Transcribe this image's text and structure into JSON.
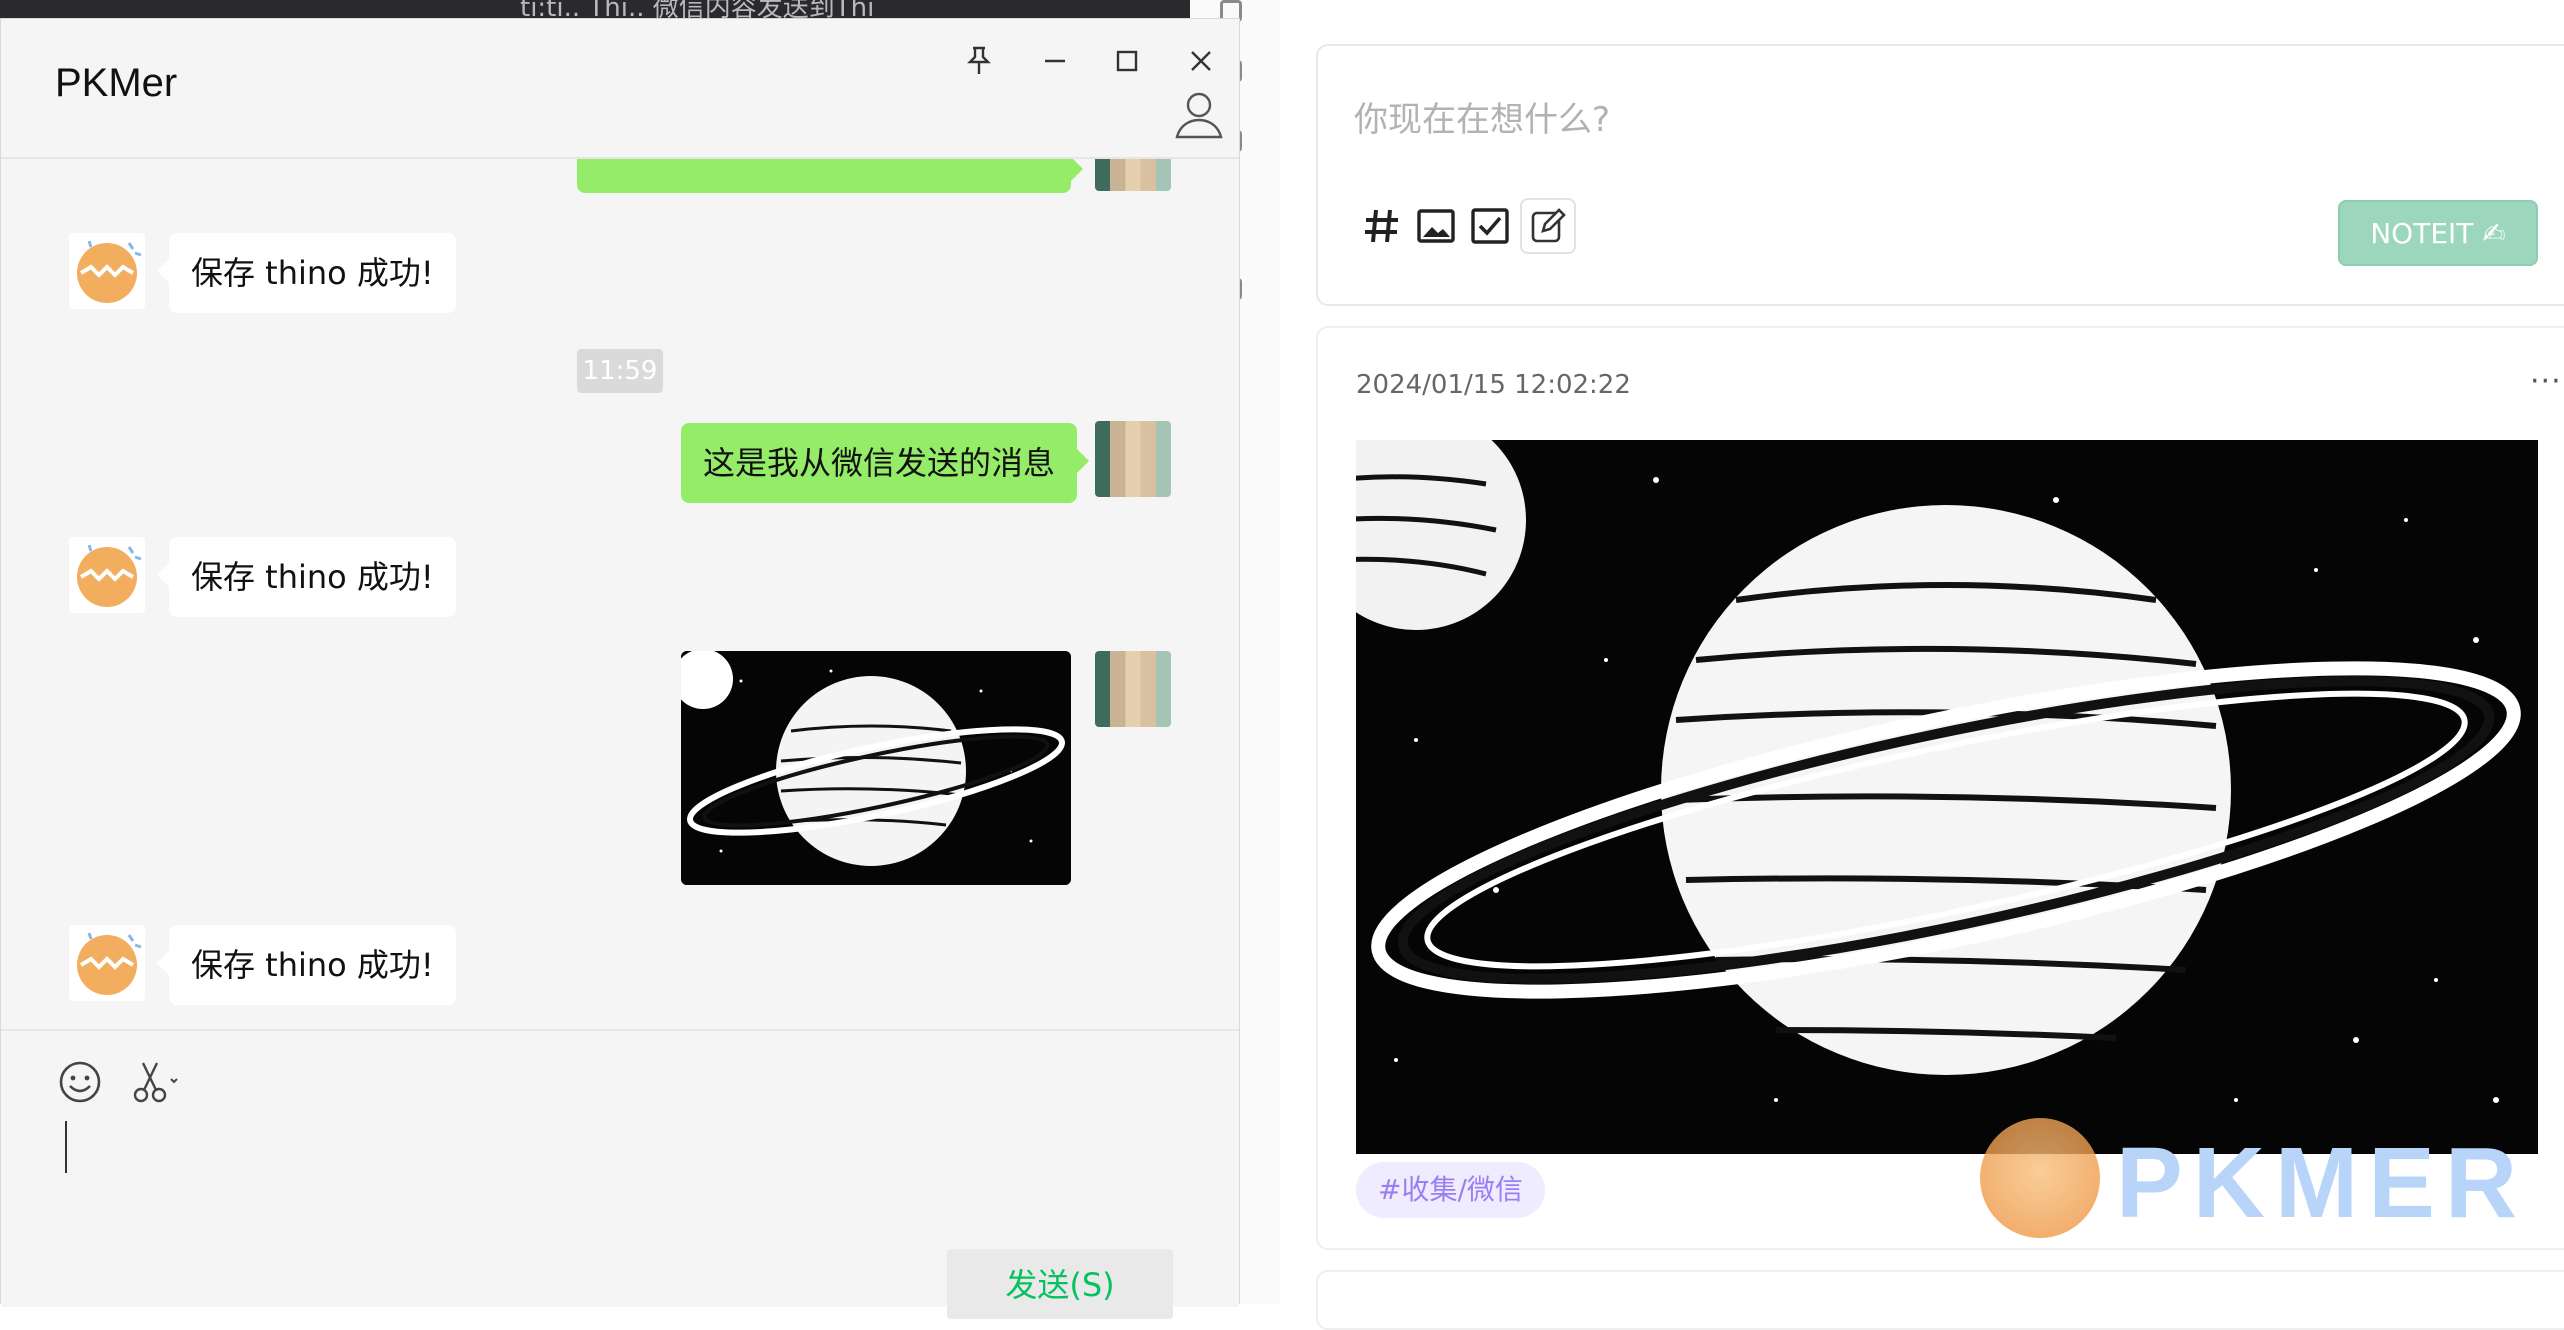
{
  "background_editor": {
    "snippet": "ti:ti.. Thi..   微信内容发送到Thi"
  },
  "wechat": {
    "title": "PKMer",
    "messages": {
      "timestamp": "11:59",
      "bot_reply_1": "保存 thino 成功!",
      "user_text": "这是我从微信发送的消息",
      "bot_reply_2": "保存 thino 成功!",
      "bot_reply_3": "保存 thino 成功!"
    },
    "send_label": "发送(S)",
    "icons": {
      "pin": "pin-icon",
      "minimize": "minimize-icon",
      "maximize": "maximize-icon",
      "close": "close-icon",
      "profile": "user-icon",
      "emoji": "emoji-icon",
      "screenshot": "scissors-icon"
    },
    "colors": {
      "out_bubble": "#95ec69",
      "send_text": "#07c160"
    }
  },
  "thino": {
    "editor": {
      "placeholder": "你现在在想什么?",
      "noteit_label": "NOTEIT ✍"
    },
    "memo": {
      "timestamp": "2024/01/15 12:02:22",
      "more": "···",
      "tag": "#收集/微信"
    },
    "colors": {
      "noteit": "#9bd6bd",
      "tag_text": "#9a7ff0",
      "tag_bg": "#f0ecff"
    }
  },
  "watermark": {
    "text": "PKMER"
  }
}
